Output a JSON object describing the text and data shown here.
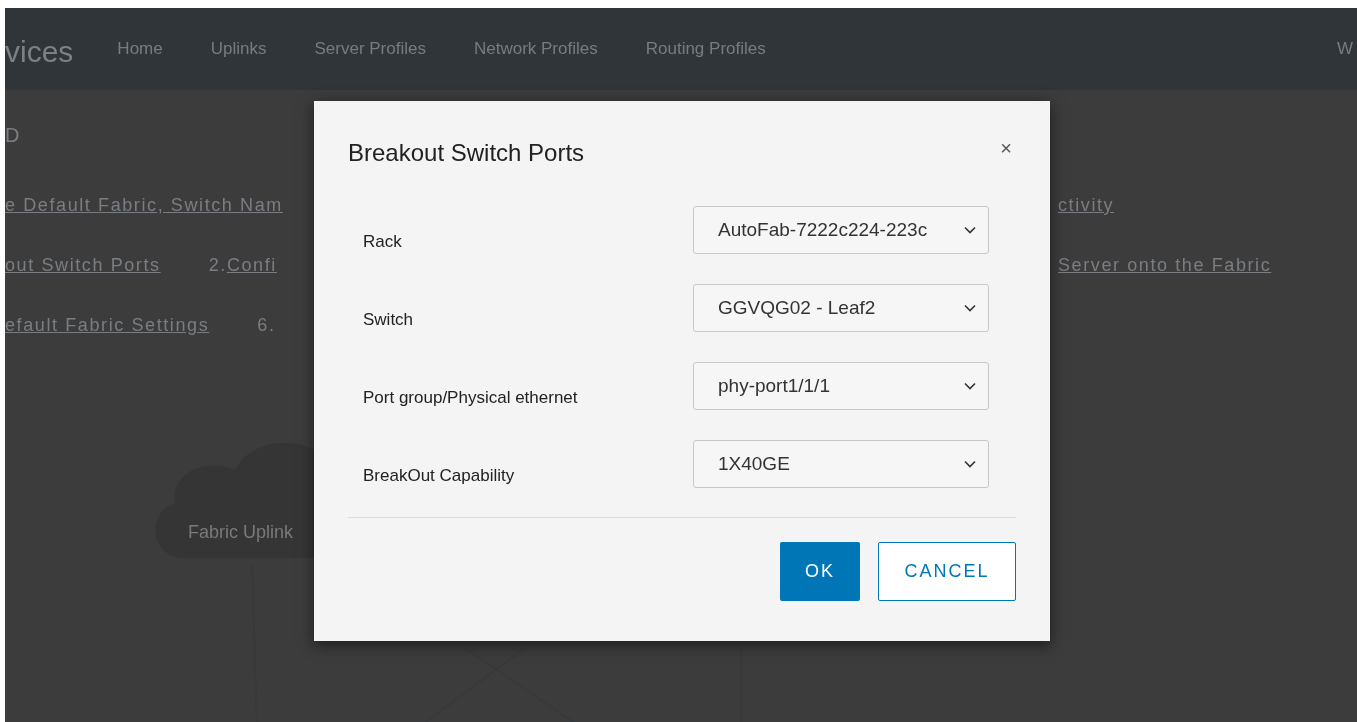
{
  "app": {
    "title": "vices",
    "nav": [
      {
        "label": "Home"
      },
      {
        "label": "Uplinks"
      },
      {
        "label": "Server Profiles"
      },
      {
        "label": "Network Profiles"
      },
      {
        "label": "Routing Profiles"
      }
    ],
    "nav_right": "W"
  },
  "page": {
    "heading": "D",
    "link_rows": [
      {
        "left": [
          {
            "text": "e Default Fabric, Switch Nam"
          }
        ],
        "right": [
          {
            "text": "ctivity"
          }
        ]
      },
      {
        "left": [
          {
            "text": "out Switch Ports"
          },
          {
            "number": "2.",
            "text": "Confi"
          }
        ],
        "right": [
          {
            "text": "Server onto the Fabric"
          }
        ]
      },
      {
        "left": [
          {
            "text": "efault Fabric Settings"
          },
          {
            "number": "6."
          }
        ],
        "right": []
      }
    ],
    "diagram": {
      "cloud_label": "Fabric Uplink"
    }
  },
  "dialog": {
    "title": "Breakout Switch Ports",
    "close": "×",
    "fields": [
      {
        "label": "Rack",
        "value": "AutoFab-7222c224-223c"
      },
      {
        "label": "Switch",
        "value": "GGVQG02 - Leaf2"
      },
      {
        "label": "Port group/Physical ethernet",
        "value": "phy-port1/1/1"
      },
      {
        "label": "BreakOut Capability",
        "value": "1X40GE"
      }
    ],
    "buttons": [
      {
        "label": "OK",
        "kind": "primary"
      },
      {
        "label": "CANCEL",
        "kind": "secondary"
      }
    ]
  }
}
